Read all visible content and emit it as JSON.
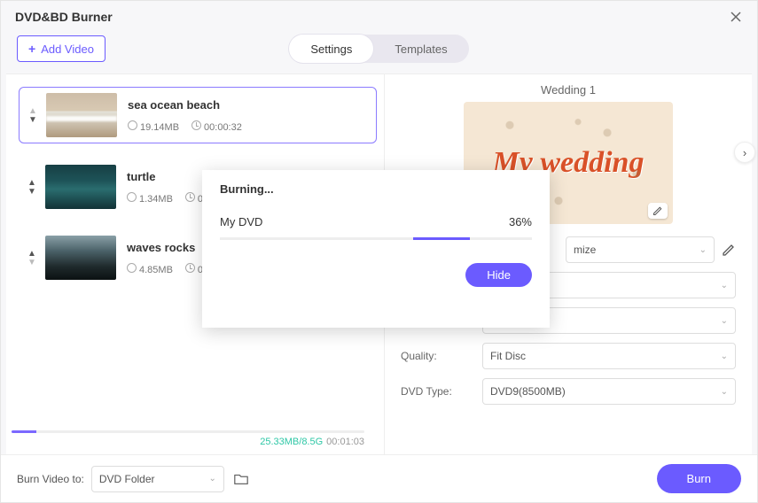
{
  "window": {
    "title": "DVD&BD Burner"
  },
  "topbar": {
    "add_video": "Add Video"
  },
  "tabs": {
    "settings": "Settings",
    "templates": "Templates"
  },
  "videos": [
    {
      "name": "sea ocean beach",
      "size": "19.14MB",
      "duration": "00:00:32"
    },
    {
      "name": "turtle",
      "size": "1.34MB",
      "duration": "0"
    },
    {
      "name": "waves rocks",
      "size": "4.85MB",
      "duration": "0"
    }
  ],
  "status": {
    "size_ratio": "25.33MB/8.5G",
    "total_duration": "00:01:03"
  },
  "rightpanel": {
    "template_title": "Wedding 1",
    "template_text": "My wedding",
    "rows": {
      "r0_value": "mize",
      "quality_label": "Quality:",
      "quality_value": "Fit Disc",
      "dvdtype_label": "DVD Type:",
      "dvdtype_value": "DVD9(8500MB)"
    }
  },
  "modal": {
    "heading": "Burning...",
    "disc_name": "My DVD",
    "percent_text": "36%",
    "percent_value": 36,
    "hide": "Hide"
  },
  "footer": {
    "label": "Burn Video to:",
    "destination": "DVD Folder",
    "burn": "Burn"
  }
}
